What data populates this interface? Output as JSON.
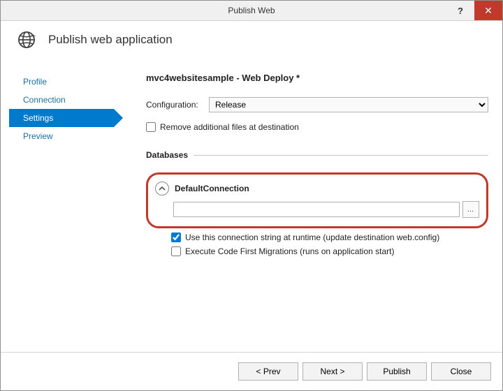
{
  "window": {
    "title": "Publish Web",
    "help": "?",
    "close": "✕"
  },
  "header": {
    "subtitle": "Publish web application"
  },
  "sidebar": {
    "items": [
      {
        "label": "Profile",
        "active": false
      },
      {
        "label": "Connection",
        "active": false
      },
      {
        "label": "Settings",
        "active": true
      },
      {
        "label": "Preview",
        "active": false
      }
    ]
  },
  "content": {
    "page_title": "mvc4websitesample - Web Deploy *",
    "configuration_label": "Configuration:",
    "configuration_value": "Release",
    "remove_files_label": "Remove additional files at destination",
    "databases_section": "Databases",
    "db": {
      "name": "DefaultConnection",
      "connection_string": "",
      "browse_label": "…",
      "use_runtime_label": "Use this connection string at runtime (update destination web.config)",
      "exec_migrations_label": "Execute Code First Migrations (runs on application start)"
    }
  },
  "footer": {
    "prev": "< Prev",
    "next": "Next >",
    "publish": "Publish",
    "close": "Close"
  }
}
